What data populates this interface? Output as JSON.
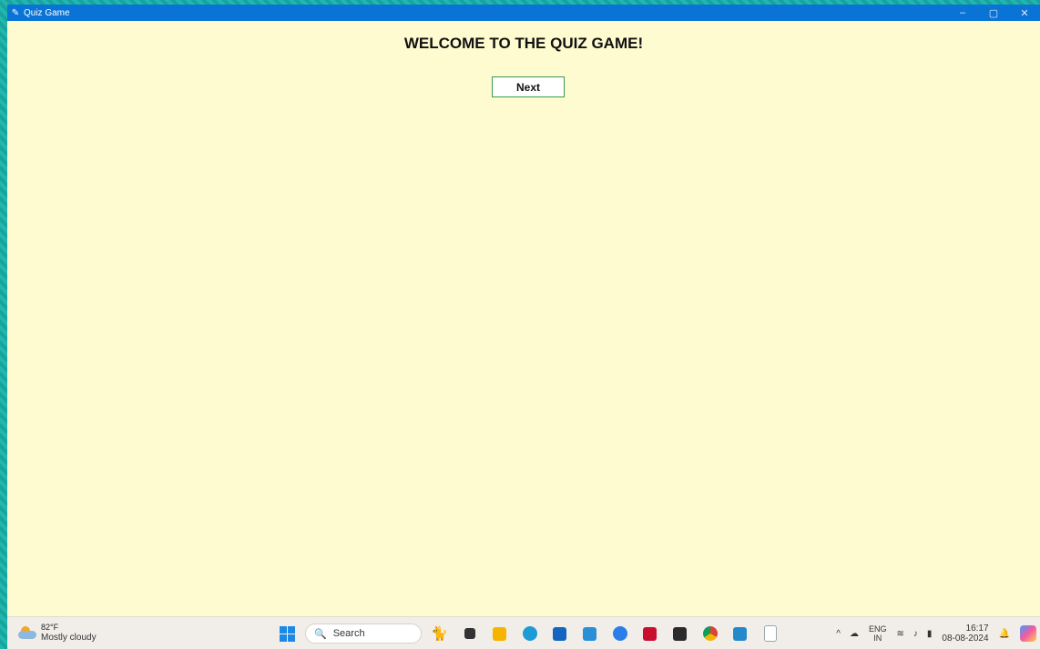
{
  "window": {
    "title": "Quiz Game",
    "controls": {
      "minimize": "–",
      "restore": "▢",
      "close": "✕"
    }
  },
  "main": {
    "heading": "WELCOME TO THE QUIZ GAME!",
    "next_button": "Next"
  },
  "taskbar": {
    "weather": {
      "temperature": "82°F",
      "condition": "Mostly cloudy"
    },
    "search_label": "Search",
    "pinned_apps": [
      "start-icon",
      "search-box",
      "cat-widget-icon",
      "task-view-icon",
      "file-explorer-icon",
      "edge-icon",
      "store-icon",
      "mail-app-icon",
      "copilot-app-icon",
      "mcafee-icon",
      "terminal-icon",
      "chrome-icon",
      "vscode-icon",
      "notepad-icon"
    ],
    "tray": {
      "lang_top": "ENG",
      "lang_bottom": "IN",
      "time": "16:17",
      "date": "08-08-2024"
    }
  },
  "colors": {
    "window_bg": "#fffbd0",
    "titlebar": "#0a74d6",
    "button_border": "#3a9a4a",
    "desktop": "#1fb8b0"
  }
}
